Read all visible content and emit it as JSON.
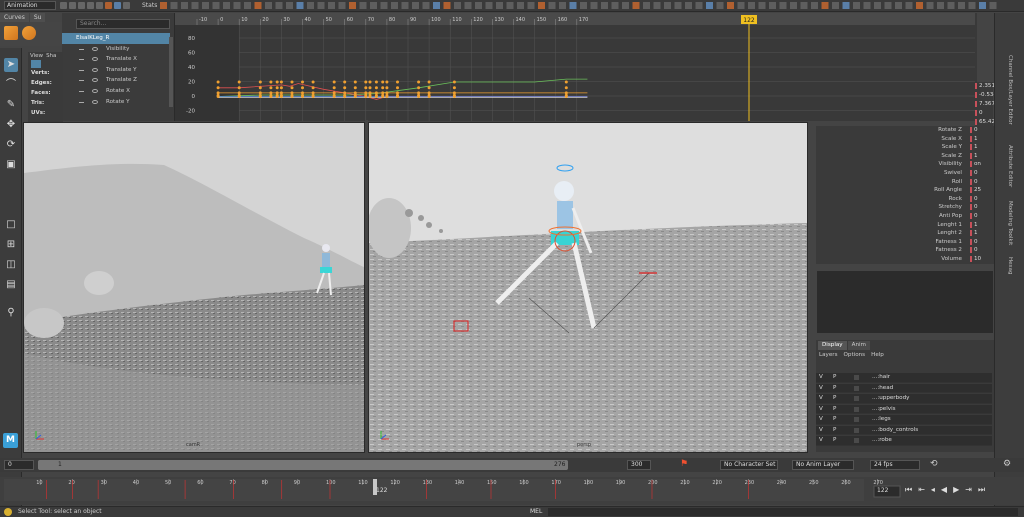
{
  "topbar": {
    "menu_set": "Animation",
    "stats_label": "Stats"
  },
  "shelf": {
    "tabs": [
      "Curves",
      "Su"
    ]
  },
  "outliner": {
    "search_placeholder": "Search...",
    "selected_node": "ElsaIKLeg_R",
    "channels": [
      {
        "label": "Visibility",
        "color": "#bbbbbb"
      },
      {
        "label": "Translate X",
        "color": "#e05050"
      },
      {
        "label": "Translate Y",
        "color": "#5ac85a"
      },
      {
        "label": "Translate Z",
        "color": "#5a8ae0"
      },
      {
        "label": "Rotate X",
        "color": "#e05050"
      },
      {
        "label": "Rotate Y",
        "color": "#5ac85a"
      }
    ]
  },
  "component_info": {
    "tabs": [
      "View",
      "Sha"
    ],
    "rows": [
      "Verts:",
      "Edges:",
      "Faces:",
      "Tris:",
      "UVs:"
    ]
  },
  "graph": {
    "ruler_ticks": [
      "-10",
      "0",
      "10",
      "20",
      "30",
      "40",
      "50",
      "60",
      "70",
      "80",
      "90",
      "100",
      "110",
      "120",
      "130",
      "140",
      "150",
      "160",
      "170"
    ],
    "current_frame": "122",
    "y_labels": [
      "80",
      "60",
      "40",
      "20",
      "0",
      "-20"
    ]
  },
  "channel_box": {
    "top_values": [
      "2.351",
      "-0.534",
      "7.367",
      "0",
      "65.426"
    ],
    "rows": [
      {
        "label": "Rotate Z",
        "value": "0"
      },
      {
        "label": "Scale X",
        "value": "1"
      },
      {
        "label": "Scale Y",
        "value": "1"
      },
      {
        "label": "Scale Z",
        "value": "1"
      },
      {
        "label": "Visibility",
        "value": "on"
      },
      {
        "label": "Swivel",
        "value": "0"
      },
      {
        "label": "Roll",
        "value": "0"
      },
      {
        "label": "Roll Angle",
        "value": "25"
      },
      {
        "label": "Rock",
        "value": "0"
      },
      {
        "label": "Stretchy",
        "value": "0"
      },
      {
        "label": "Anti Pop",
        "value": "0"
      },
      {
        "label": "Lenght 1",
        "value": "1"
      },
      {
        "label": "Lenght 2",
        "value": "1"
      },
      {
        "label": "Fatness 1",
        "value": "0"
      },
      {
        "label": "Fatness 2",
        "value": "0"
      },
      {
        "label": "Volume",
        "value": "10"
      }
    ]
  },
  "right_tabs": [
    "Channel Box/Layer Editor",
    "Attribute Editor",
    "Modeling Toolkit",
    "Hexag"
  ],
  "viewports": {
    "left_camera": "camR",
    "right_camera": "persp"
  },
  "layers": {
    "tabs": [
      "Display",
      "Anim"
    ],
    "menu": [
      "Layers",
      "Options",
      "Help"
    ],
    "rows": [
      "...:hair",
      "...:head",
      "...:upperbody",
      "...:pelvis",
      "...:legs",
      "...:body_controls",
      "...:robe"
    ]
  },
  "timebar": {
    "start": "0",
    "range_start": "1",
    "range_end": "276",
    "end": "300",
    "character_set": "No Character Set",
    "anim_layer": "No Anim Layer",
    "fps": "24 fps"
  },
  "timeline": {
    "ticks": [
      "10",
      "20",
      "30",
      "40",
      "50",
      "60",
      "70",
      "80",
      "90",
      "100",
      "110",
      "120",
      "130",
      "140",
      "150",
      "160",
      "170",
      "180",
      "190",
      "200",
      "210",
      "220",
      "230",
      "240",
      "250",
      "260",
      "270"
    ],
    "current_frame": "122"
  },
  "status": {
    "help_text": "Select Tool: select an object",
    "mel_label": "MEL"
  },
  "colors": {
    "selection": "#5285a6",
    "accent_orange": "#f0a030",
    "key_red": "#c83232",
    "maya_blue": "#3aa0d8"
  }
}
